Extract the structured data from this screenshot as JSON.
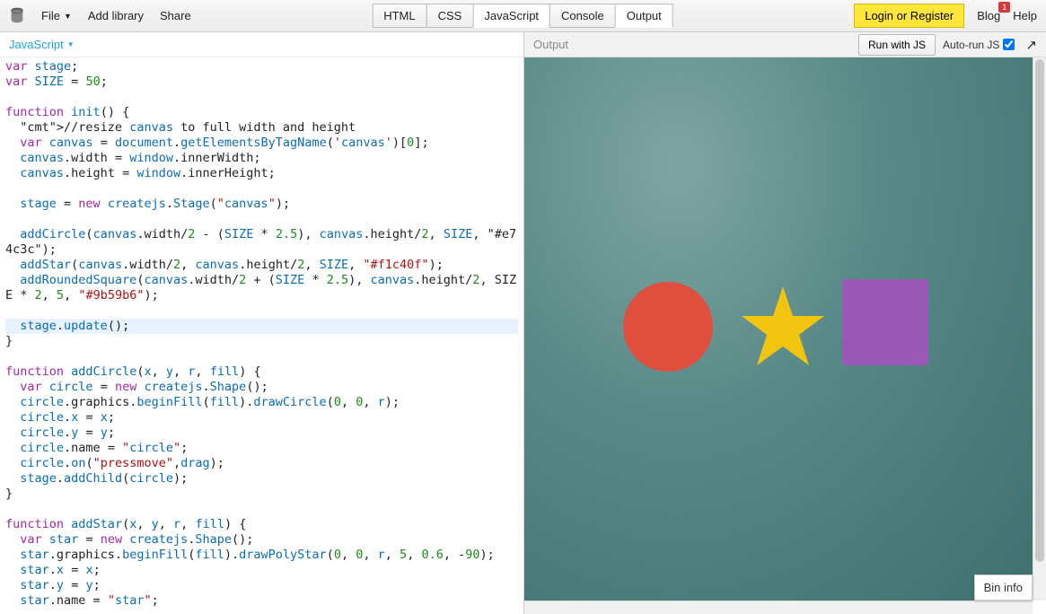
{
  "topbar": {
    "file_label": "File",
    "add_library_label": "Add library",
    "share_label": "Share",
    "login_label": "Login or Register",
    "blog_label": "Blog",
    "blog_badge": "1",
    "help_label": "Help"
  },
  "panel_tabs": {
    "html": "HTML",
    "css": "CSS",
    "js": "JavaScript",
    "console": "Console",
    "output": "Output",
    "active": [
      "js",
      "output"
    ]
  },
  "editor": {
    "dropdown_label": "JavaScript"
  },
  "output": {
    "title": "Output",
    "run_label": "Run with JS",
    "autorun_label": "Auto-run JS",
    "autorun_checked": true,
    "bin_info_label": "Bin info",
    "shapes": {
      "circle_color": "#e74c3c",
      "star_color": "#f1c40f",
      "square_color": "#9b59b6"
    }
  },
  "code": {
    "lines": [
      "var stage;",
      "var SIZE = 50;",
      "",
      "function init() {",
      "  //resize canvas to full width and height",
      "  var canvas = document.getElementsByTagName('canvas')[0];",
      "  canvas.width = window.innerWidth;",
      "  canvas.height = window.innerHeight;",
      "",
      "  stage = new createjs.Stage(\"canvas\");",
      "",
      "  addCircle(canvas.width/2 - (SIZE * 2.5), canvas.height/2, SIZE, \"#e74c3c\");",
      "  addStar(canvas.width/2, canvas.height/2, SIZE, \"#f1c40f\");",
      "  addRoundedSquare(canvas.width/2 + (SIZE * 2.5), canvas.height/2, SIZE * 2, 5, \"#9b59b6\");",
      "",
      "  stage.update();",
      "}",
      "",
      "function addCircle(x, y, r, fill) {",
      "  var circle = new createjs.Shape();",
      "  circle.graphics.beginFill(fill).drawCircle(0, 0, r);",
      "  circle.x = x;",
      "  circle.y = y;",
      "  circle.name = \"circle\";",
      "  circle.on(\"pressmove\",drag);",
      "  stage.addChild(circle);",
      "}",
      "",
      "function addStar(x, y, r, fill) {",
      "  var star = new createjs.Shape();",
      "  star.graphics.beginFill(fill).drawPolyStar(0, 0, r, 5, 0.6, -90);",
      "  star.x = x;",
      "  star.y = y;",
      "  star.name = \"star\";"
    ],
    "highlighted_line_index": 15
  }
}
